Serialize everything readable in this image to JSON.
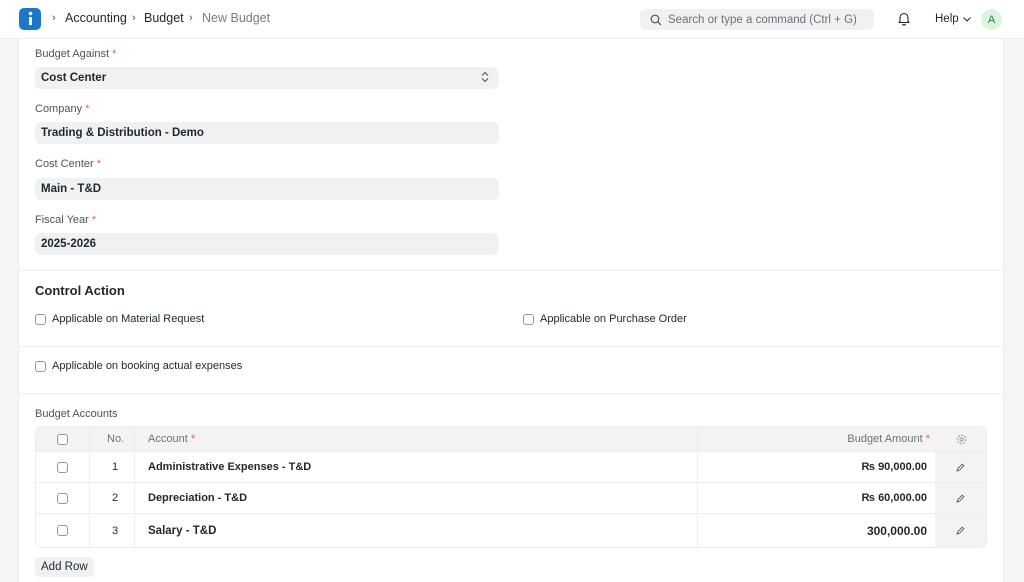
{
  "breadcrumbs": [
    "Accounting",
    "Budget",
    "New Budget"
  ],
  "search": {
    "placeholder": "Search or type a command (Ctrl + G)"
  },
  "help_label": "Help",
  "avatar_initial": "A",
  "fields": {
    "budget_against": {
      "label": "Budget Against",
      "value": "Cost Center"
    },
    "company": {
      "label": "Company",
      "value": "Trading & Distribution - Demo"
    },
    "cost_center": {
      "label": "Cost Center",
      "value": "Main - T&D"
    },
    "fiscal_year": {
      "label": "Fiscal Year",
      "value": "2025-2026"
    }
  },
  "control_action": {
    "title": "Control Action",
    "material_request": "Applicable on Material Request",
    "purchase_order": "Applicable on Purchase Order",
    "actual_expenses": "Applicable on booking actual expenses"
  },
  "budget_accounts": {
    "label": "Budget Accounts",
    "columns": {
      "no": "No.",
      "account": "Account",
      "amount": "Budget Amount"
    },
    "rows": [
      {
        "no": "1",
        "account": "Administrative Expenses - T&D",
        "amount": "₨ 90,000.00"
      },
      {
        "no": "2",
        "account": "Depreciation - T&D",
        "amount": "₨ 60,000.00"
      },
      {
        "no": "3",
        "account": "Salary - T&D",
        "amount": "300,000.00"
      }
    ],
    "add_row": "Add Row"
  },
  "colors": {
    "accent": "#1b78c8",
    "required": "#e25c5c"
  }
}
